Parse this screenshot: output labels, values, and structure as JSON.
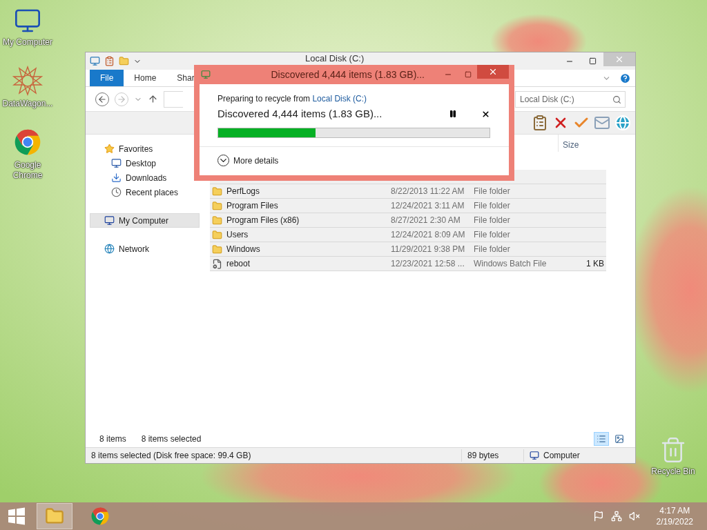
{
  "desktop_icons": [
    {
      "label": "My Computer",
      "kind": "computer"
    },
    {
      "label": "DataWagon...",
      "kind": "star-shortcut"
    },
    {
      "label": "Google Chrome",
      "kind": "chrome-shortcut"
    },
    {
      "label": "Recycle Bin",
      "kind": "recycle"
    }
  ],
  "explorer": {
    "title": "Local Disk (C:)",
    "ribbon_tabs": [
      {
        "label": "File",
        "kind": "file-menu"
      },
      {
        "label": "Home",
        "kind": "tab"
      },
      {
        "label": "Shar",
        "kind": "tab"
      }
    ],
    "search_placeholder": "Local Disk (C:)",
    "size_column": "Size",
    "sidebar": [
      {
        "label": "Favorites",
        "kind": "star",
        "selected": false,
        "children": [
          {
            "label": "Desktop",
            "kind": "desktop",
            "selected": false
          },
          {
            "label": "Downloads",
            "kind": "downloads",
            "selected": false
          },
          {
            "label": "Recent places",
            "kind": "recent",
            "selected": false
          }
        ]
      },
      {
        "label": "My Computer",
        "kind": "computer",
        "selected": true
      },
      {
        "label": "Network",
        "kind": "network",
        "selected": false
      }
    ],
    "files": [
      {
        "name": "PerfLogs",
        "modified": "8/22/2013 11:22 AM",
        "type": "File folder",
        "kind": "folder",
        "selected": true
      },
      {
        "name": "Program Files",
        "modified": "12/24/2021 3:11 AM",
        "type": "File folder",
        "kind": "folder",
        "selected": true
      },
      {
        "name": "Program Files (x86)",
        "modified": "8/27/2021 2:30 AM",
        "type": "File folder",
        "kind": "folder",
        "selected": true
      },
      {
        "name": "Users",
        "modified": "12/24/2021 8:09 AM",
        "type": "File folder",
        "kind": "folder",
        "selected": true
      },
      {
        "name": "Windows",
        "modified": "11/29/2021 9:38 PM",
        "type": "File folder",
        "kind": "folder",
        "selected": true
      },
      {
        "name": "reboot",
        "modified": "12/23/2021 12:58 ...",
        "type": "Windows Batch File",
        "size": "1 KB",
        "kind": "batch",
        "selected": true
      }
    ],
    "footer": {
      "item_count": "8 items",
      "selected_count": "8 items selected"
    },
    "view_buttons": [
      {
        "kind": "details",
        "selected": true
      },
      {
        "kind": "large-icons",
        "selected": false
      }
    ],
    "status_bar": {
      "selection": "8 items selected (Disk free space: 99.4 GB)",
      "size": "89 bytes",
      "location": "Computer"
    }
  },
  "dialog": {
    "title": "Discovered 4,444 items (1.83 GB)...",
    "source_text": "Preparing to recycle from",
    "source_link": "Local Disk (C:)",
    "status": "Discovered 4,444 items (1.83 GB)...",
    "level": 0.36,
    "more_details": "More details"
  },
  "taskbar": {
    "apps": [
      {
        "kind": "explorer",
        "selected": true
      },
      {
        "kind": "chrome",
        "selected": false
      }
    ],
    "clock": {
      "time": "4:17 AM",
      "date": "2/19/2022"
    }
  }
}
